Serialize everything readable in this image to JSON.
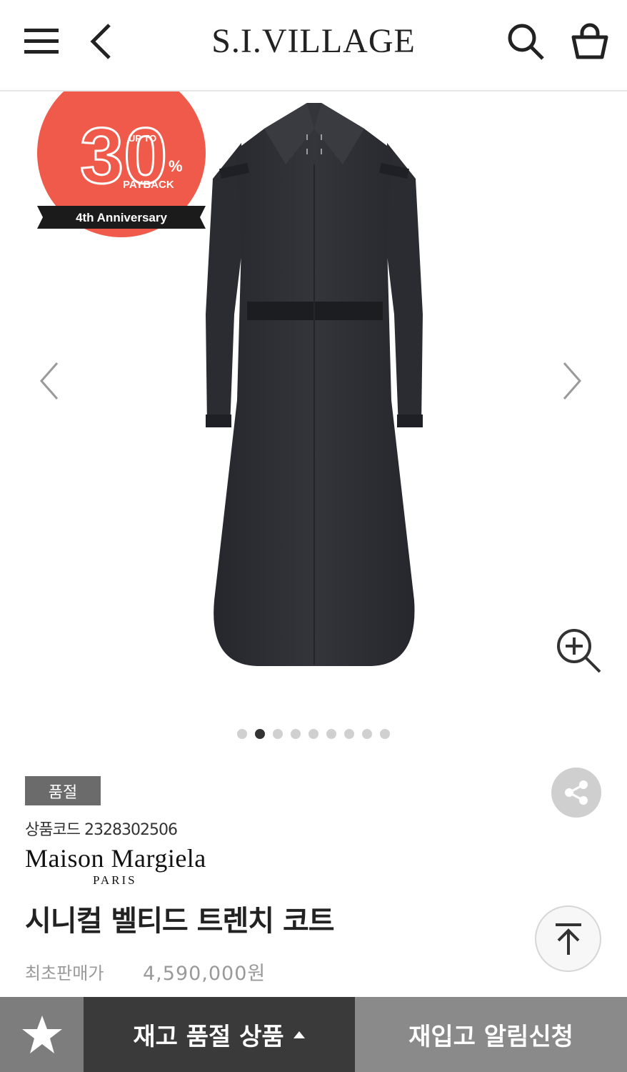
{
  "header": {
    "logo": "S.I.VILLAGE",
    "menu_icon": "hamburger-menu-icon",
    "back_icon": "chevron-left-icon",
    "search_icon": "search-icon",
    "cart_icon": "shopping-basket-icon"
  },
  "promo_badge": {
    "big_number": "30",
    "up_to": "UP TO",
    "percent": "%",
    "payback": "PAYBACK",
    "ribbon": "4th Anniversary",
    "color": "#f05a4a"
  },
  "gallery": {
    "dots_total": 9,
    "active_index": 1
  },
  "product": {
    "status_tag": "품절",
    "code_label": "상품코드",
    "code": "2328302506",
    "brand": "Maison Margiela",
    "brand_sub": "PARIS",
    "name": "시니컬 벨티드 트렌치 코트",
    "price_label": "최초판매가",
    "price": "4,590,000원"
  },
  "bottom_bar": {
    "wish_icon": "star-icon",
    "soldout_label": "재고 품절 상품",
    "restock_label": "재입고 알림신청"
  },
  "colors": {
    "soldout_tag": "#6b6b6b",
    "soldout_button": "#3a3a3a",
    "restock_button": "#8a8a8a",
    "coat": "#2f3036"
  }
}
